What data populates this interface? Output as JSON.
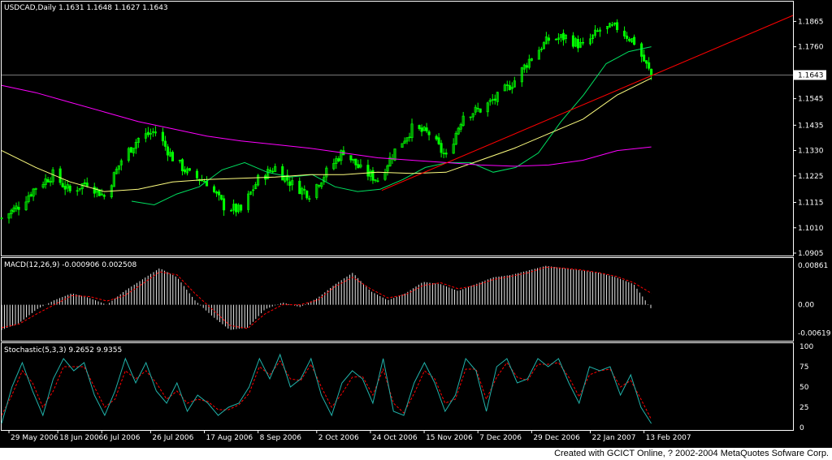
{
  "header": {
    "price_title": "USDCAD,Daily  1.1631 1.1648 1.1627 1.1643",
    "macd_title": "MACD(12,26,9)  -0.000906  0.002508",
    "stoch_title": "Stochastic(5,3,3)  9.2652  9.9355"
  },
  "footer": {
    "credit": "Created with GCICT Online, ? 2002-2004 MetaQuotes Sofware Corp."
  },
  "colors": {
    "background": "#000000",
    "panel_border": "#ffffff",
    "bull": "#00ff00",
    "bear": "#00ff00",
    "ma_fast": "#00e060",
    "ma_mid": "#ffff80",
    "ma_slow": "#ff00ff",
    "trendline": "#ff0000",
    "macd_hist": "#ffffff",
    "macd_signal": "#ff0000",
    "stoch_main": "#20b2aa",
    "stoch_signal": "#ff0000"
  },
  "chart_data": [
    {
      "type": "line",
      "panel": "price",
      "symbol": "USDCAD",
      "timeframe": "Daily",
      "ohlc_last": {
        "open": 1.1631,
        "high": 1.1648,
        "low": 1.1627,
        "close": 1.1643
      },
      "current_price_label": "1.1643",
      "current_price": 1.1643,
      "ylim": [
        1.0905,
        1.19
      ],
      "y_ticks": [
        1.1865,
        1.176,
        1.1643,
        1.1545,
        1.1435,
        1.133,
        1.1225,
        1.1115,
        1.101,
        1.0905
      ],
      "y_tick_labels": [
        "1.1865",
        "1.1760",
        "1.1545",
        "1.1435",
        "1.1330",
        "1.1225",
        "1.1115",
        "1.1010",
        "1.0905"
      ],
      "x_tick_labels": [
        "29 May 2006",
        "18 Jun 2006",
        "6 Jul 2006",
        "26 Jul 2006",
        "17 Aug 2006",
        "8 Sep 2006",
        "2 Oct 2006",
        "24 Oct 2006",
        "15 Nov 2006",
        "7 Dec 2006",
        "29 Dec 2006",
        "22 Jan 2007",
        "13 Feb 2007"
      ],
      "x_tick_dates": [
        "2006-05-29",
        "2006-06-18",
        "2006-07-06",
        "2006-07-26",
        "2006-08-17",
        "2006-09-08",
        "2006-10-02",
        "2006-10-24",
        "2006-11-15",
        "2006-12-07",
        "2006-12-29",
        "2007-01-22",
        "2007-02-13"
      ],
      "xlim": [
        "2006-05-26",
        "2007-04-15"
      ],
      "close_series": {
        "dates": [
          "2006-05-26",
          "2006-06-02",
          "2006-06-09",
          "2006-06-16",
          "2006-06-23",
          "2006-06-30",
          "2006-07-07",
          "2006-07-14",
          "2006-07-21",
          "2006-07-28",
          "2006-08-04",
          "2006-08-11",
          "2006-08-18",
          "2006-08-25",
          "2006-09-01",
          "2006-09-08",
          "2006-09-15",
          "2006-09-22",
          "2006-09-29",
          "2006-10-06",
          "2006-10-13",
          "2006-10-20",
          "2006-10-27",
          "2006-11-03",
          "2006-11-10",
          "2006-11-17",
          "2006-11-24",
          "2006-12-01",
          "2006-12-08",
          "2006-12-15",
          "2006-12-22",
          "2006-12-29",
          "2007-01-05",
          "2007-01-12",
          "2007-01-19",
          "2007-01-26",
          "2007-02-02",
          "2007-02-09",
          "2007-02-16"
        ],
        "values": [
          1.105,
          1.11,
          1.118,
          1.123,
          1.116,
          1.12,
          1.114,
          1.129,
          1.138,
          1.141,
          1.13,
          1.123,
          1.12,
          1.11,
          1.108,
          1.121,
          1.126,
          1.119,
          1.115,
          1.124,
          1.133,
          1.125,
          1.121,
          1.133,
          1.142,
          1.14,
          1.13,
          1.148,
          1.15,
          1.155,
          1.162,
          1.172,
          1.179,
          1.18,
          1.176,
          1.183,
          1.184,
          1.178,
          1.1643
        ]
      },
      "series": [
        {
          "values": [
            1.112,
            1.1105,
            1.115,
            1.118,
            1.125,
            1.128,
            1.124,
            1.122,
            1.123,
            1.118,
            1.116,
            1.117,
            1.121,
            1.126,
            1.128,
            1.128,
            1.124,
            1.126,
            1.132,
            1.145,
            1.156,
            1.169,
            1.174,
            1.176
          ]
        },
        {
          "values": [
            1.133,
            1.126,
            1.12,
            1.116,
            1.117,
            1.12,
            1.121,
            1.1215,
            1.122,
            1.123,
            1.123,
            1.124,
            1.1235,
            1.124,
            1.129,
            1.134,
            1.14,
            1.146,
            1.156,
            1.163
          ]
        },
        {
          "values": [
            1.16,
            1.157,
            1.153,
            1.149,
            1.145,
            1.142,
            1.139,
            1.137,
            1.1355,
            1.134,
            1.132,
            1.13,
            1.129,
            1.128,
            1.127,
            1.1265,
            1.127,
            1.129,
            1.133,
            1.1345
          ]
        },
        {
          "values": [
            1.1165,
            1.189
          ]
        }
      ]
    },
    {
      "type": "bar",
      "panel": "macd",
      "ylim": [
        -0.0075,
        0.0095
      ],
      "y_tick_labels": [
        "0.00861",
        "0.00",
        "-0.00619"
      ],
      "y_ticks": [
        0.00861,
        0.0,
        -0.00619
      ],
      "histogram": [
        -0.0055,
        -0.004,
        -0.001,
        0.001,
        0.0025,
        0.0015,
        0.0,
        0.003,
        0.0055,
        0.008,
        0.006,
        0.001,
        -0.0025,
        -0.0055,
        -0.005,
        -0.001,
        0.0005,
        -0.0005,
        0.0015,
        0.0045,
        0.007,
        0.003,
        0.001,
        0.0025,
        0.005,
        0.0045,
        0.003,
        0.0045,
        0.006,
        0.0065,
        0.0075,
        0.0085,
        0.008,
        0.0075,
        0.007,
        0.006,
        0.0045,
        -0.0009
      ],
      "signal": [
        -0.005,
        -0.0042,
        -0.002,
        0.0,
        0.002,
        0.0018,
        0.0008,
        0.002,
        0.0045,
        0.0072,
        0.0065,
        0.0025,
        -0.001,
        -0.0045,
        -0.0052,
        -0.002,
        0.0,
        0.0,
        0.001,
        0.004,
        0.006,
        0.0035,
        0.0015,
        0.0022,
        0.0042,
        0.0048,
        0.0035,
        0.0042,
        0.0055,
        0.0062,
        0.007,
        0.0082,
        0.008,
        0.0076,
        0.007,
        0.0062,
        0.0048,
        0.0025
      ]
    },
    {
      "type": "line",
      "panel": "stochastic",
      "ylim": [
        0,
        100
      ],
      "y_tick_labels": [
        "100",
        "75",
        "50",
        "25",
        "0"
      ],
      "y_ticks": [
        100,
        75,
        50,
        25,
        0
      ],
      "main": [
        5,
        50,
        80,
        45,
        15,
        60,
        85,
        70,
        80,
        40,
        15,
        45,
        85,
        55,
        80,
        45,
        30,
        55,
        20,
        40,
        30,
        15,
        25,
        30,
        50,
        85,
        60,
        90,
        50,
        60,
        85,
        40,
        15,
        55,
        70,
        60,
        30,
        85,
        20,
        15,
        55,
        80,
        55,
        20,
        40,
        85,
        70,
        20,
        75,
        85,
        55,
        60,
        85,
        75,
        85,
        55,
        30,
        75,
        70,
        75,
        40,
        65,
        25,
        5
      ],
      "signal": [
        15,
        40,
        70,
        55,
        25,
        45,
        75,
        75,
        75,
        50,
        25,
        35,
        70,
        60,
        70,
        55,
        35,
        45,
        30,
        35,
        32,
        22,
        22,
        28,
        42,
        75,
        65,
        82,
        60,
        58,
        78,
        50,
        25,
        42,
        62,
        63,
        40,
        72,
        30,
        18,
        42,
        70,
        60,
        30,
        35,
        72,
        72,
        35,
        62,
        80,
        62,
        58,
        78,
        78,
        80,
        62,
        38,
        65,
        70,
        72,
        50,
        58,
        35,
        10
      ]
    }
  ]
}
